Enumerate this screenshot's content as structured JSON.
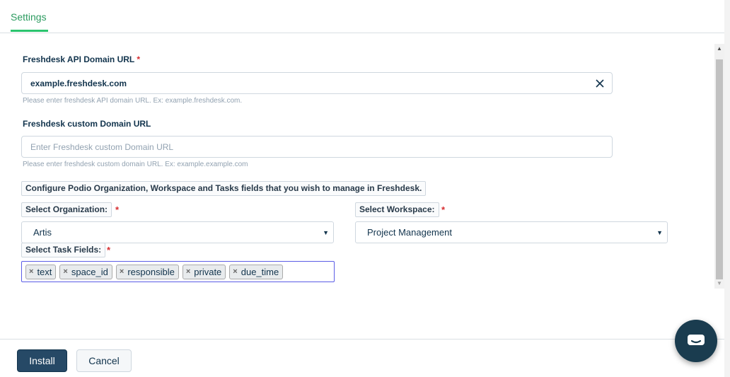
{
  "tabs": [
    {
      "label": "Settings",
      "active": true
    }
  ],
  "form": {
    "api_domain": {
      "label": "Freshdesk API Domain URL",
      "required_mark": "*",
      "value": "example.freshdesk.com",
      "help": "Please enter freshdesk API domain URL. Ex: example.freshdesk.com."
    },
    "custom_domain": {
      "label": "Freshdesk custom Domain URL",
      "placeholder": "Enter Freshdesk custom Domain URL",
      "help": "Please enter freshdesk custom domain URL. Ex: example.example.com"
    },
    "configure_note": "Configure Podio Organization, Workspace and Tasks fields that you wish to manage in Freshdesk.",
    "organization": {
      "label": "Select Organization:",
      "required_mark": "*",
      "selected": "Artis"
    },
    "workspace": {
      "label": "Select Workspace:",
      "required_mark": "*",
      "selected": "Project Management"
    },
    "task_fields": {
      "label": "Select Task Fields:",
      "required_mark": "*",
      "tags": [
        "text",
        "space_id",
        "responsible",
        "private",
        "due_time"
      ]
    }
  },
  "footer": {
    "install_label": "Install",
    "cancel_label": "Cancel"
  },
  "icons": {
    "clear": "close-icon",
    "dropdown": "caret-down-icon",
    "tag_remove": "×",
    "chat": "chat-bubble-icon",
    "scroll_up": "▲",
    "scroll_down": "▼"
  },
  "colors": {
    "accent_green": "#2bc46e",
    "primary_button": "#264966",
    "required": "#d72d30",
    "focus_border": "#5b5de6",
    "chat_fab": "#1a3c4f"
  }
}
